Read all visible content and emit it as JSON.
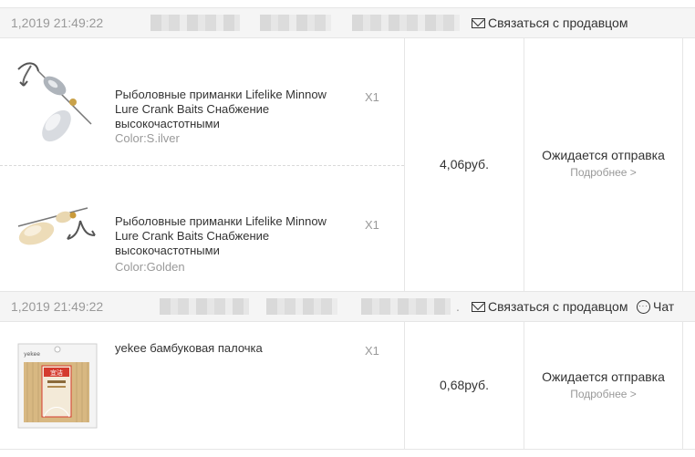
{
  "orders": [
    {
      "date": "1,2019 21:49:22",
      "contact_label": "Связаться с продавцом",
      "price": "4,06руб.",
      "status": "Ожидается отправка",
      "details_link": "Подробнее >",
      "items": [
        {
          "title": "Рыболовные приманки Lifelike Minnow Lure Crank Baits Снабжение высокочастотными",
          "qty": "X1",
          "color": "Color:S.ilver"
        },
        {
          "title": "Рыболовные приманки Lifelike Minnow Lure Crank Baits Снабжение высокочастотными",
          "qty": "X1",
          "color": "Color:Golden"
        }
      ]
    },
    {
      "date": "1,2019 21:49:22",
      "dot": ".",
      "contact_label": "Связаться с продавцом",
      "chat_label": "Чат",
      "price": "0,68руб.",
      "status": "Ожидается отправка",
      "details_link": "Подробнее >",
      "items": [
        {
          "title": "yekee бамбуковая палочка",
          "qty": "X1",
          "package_brand": "yekee",
          "package_label": "宜洁"
        }
      ]
    }
  ]
}
